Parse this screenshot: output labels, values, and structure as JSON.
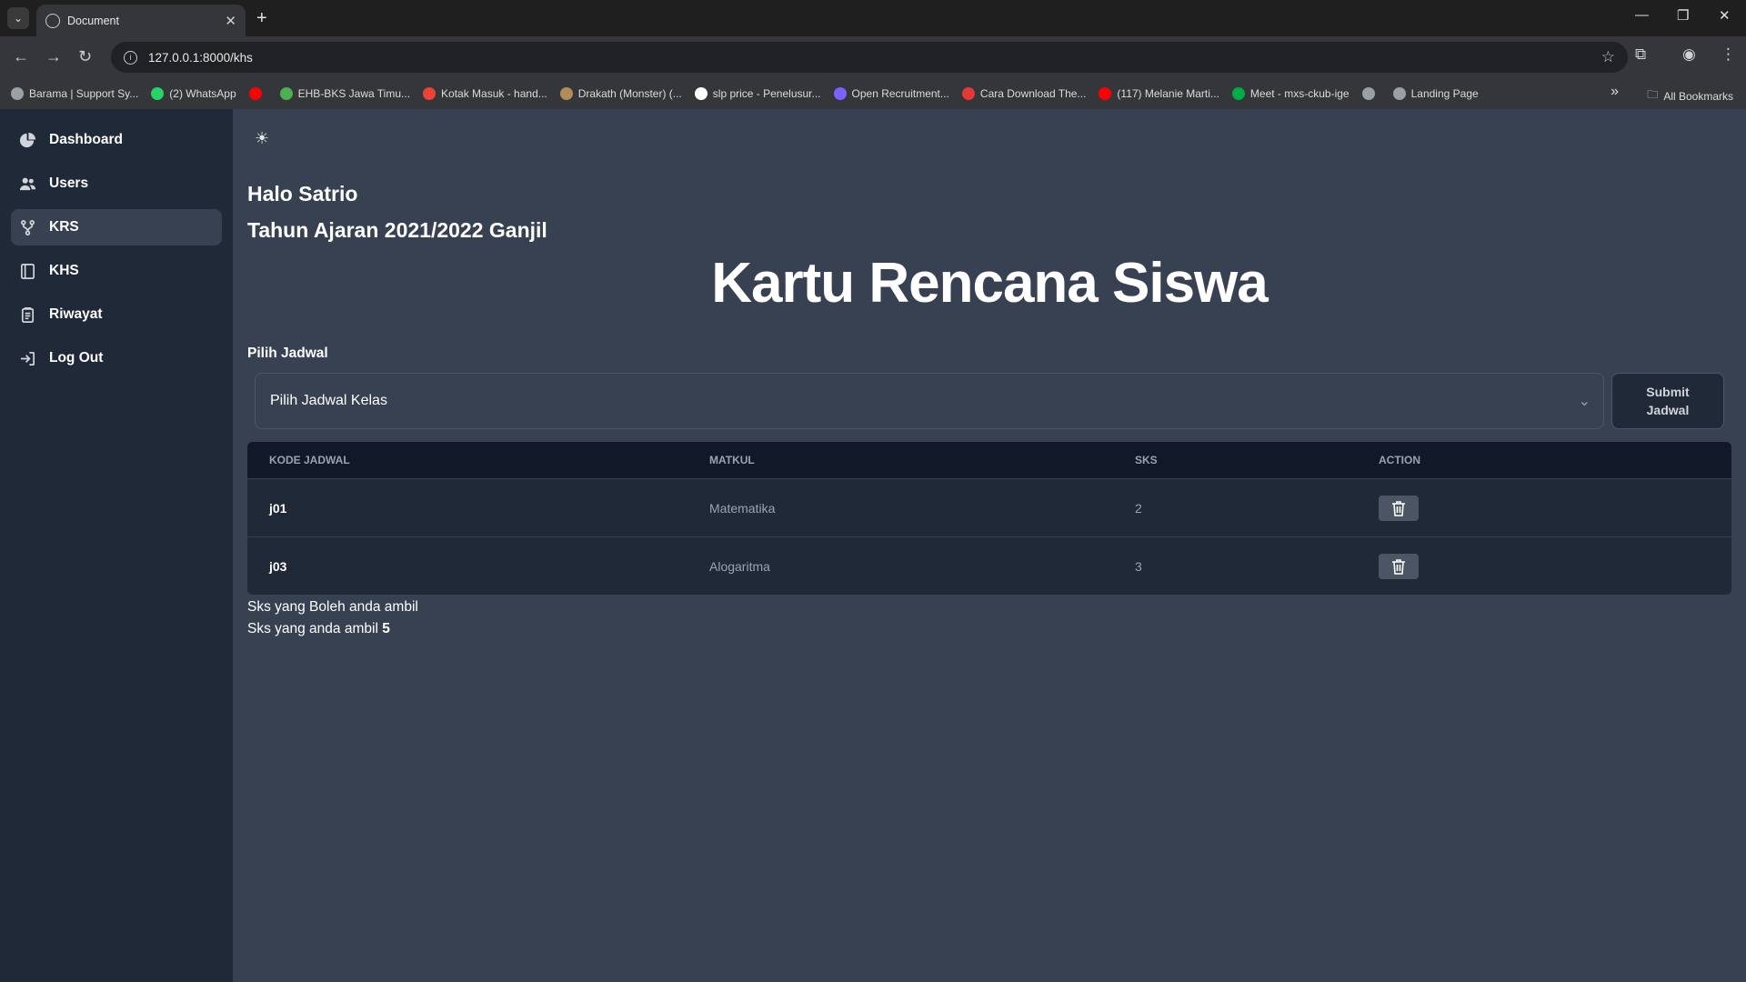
{
  "browser": {
    "tab_title": "Document",
    "url": "127.0.0.1:8000/khs",
    "bookmarks": [
      {
        "label": "Barama | Support Sy...",
        "color": "#9aa0a6"
      },
      {
        "label": "(2) WhatsApp",
        "color": "#25d366"
      },
      {
        "label": "",
        "color": "#ff0000"
      },
      {
        "label": "EHB-BKS Jawa Timu...",
        "color": "#4caf50"
      },
      {
        "label": "Kotak Masuk - hand...",
        "color": "#ea4335"
      },
      {
        "label": "Drakath (Monster) (...",
        "color": "#b08d57"
      },
      {
        "label": "slp price - Penelusur...",
        "color": "#ffffff"
      },
      {
        "label": "Open Recruitment...",
        "color": "#7b61ff"
      },
      {
        "label": "Cara Download The...",
        "color": "#e53935"
      },
      {
        "label": "(117) Melanie Marti...",
        "color": "#ff0000"
      },
      {
        "label": "Meet - mxs-ckub-ige",
        "color": "#00ac47"
      },
      {
        "label": "",
        "color": "#9aa0a6"
      },
      {
        "label": "Landing Page",
        "color": "#9aa0a6"
      }
    ],
    "all_bookmarks": "All Bookmarks"
  },
  "sidebar": {
    "items": [
      {
        "label": "Dashboard",
        "icon": "pie-chart-icon"
      },
      {
        "label": "Users",
        "icon": "users-icon"
      },
      {
        "label": "KRS",
        "icon": "branch-icon"
      },
      {
        "label": "KHS",
        "icon": "book-icon"
      },
      {
        "label": "Riwayat",
        "icon": "clipboard-icon"
      },
      {
        "label": "Log Out",
        "icon": "logout-icon"
      }
    ],
    "active": "KRS"
  },
  "main": {
    "greeting": "Halo Satrio",
    "academic_year": "Tahun Ajaran 2021/2022 Ganjil",
    "title": "Kartu Rencana Siswa",
    "form_label": "Pilih Jadwal",
    "select_value": "Pilih Jadwal Kelas",
    "submit_label": "Submit\nJadwal",
    "table": {
      "headers": [
        "KODE JADWAL",
        "MATKUL",
        "SKS",
        "ACTION"
      ],
      "rows": [
        {
          "kode": "j01",
          "matkul": "Matematika",
          "sks": "2"
        },
        {
          "kode": "j03",
          "matkul": "Alogaritma",
          "sks": "3"
        }
      ]
    },
    "sks_allowed_label": "Sks yang Boleh anda ambil",
    "sks_taken_label": "Sks yang anda ambil",
    "sks_taken_value": "5"
  }
}
